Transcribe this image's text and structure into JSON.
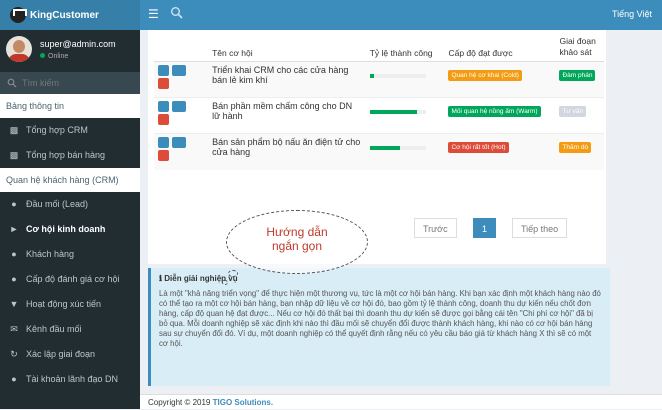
{
  "app": {
    "title": "KingCustomer",
    "language": "Tiếng Việt"
  },
  "user": {
    "name": "super@admin.com",
    "status": "Online"
  },
  "sidebar": {
    "search_placeholder": "Tìm kiếm",
    "section1": "Bảng thông tin",
    "items1": [
      {
        "label": "Tổng hợp CRM",
        "icon": "bar-chart-icon"
      },
      {
        "label": "Tổng hợp bán hàng",
        "icon": "bar-chart-icon"
      }
    ],
    "section2": "Quan hệ khách hàng (CRM)",
    "items2": [
      {
        "label": "Đầu mối (Lead)",
        "icon": "person-icon"
      },
      {
        "label": "Cơ hội kinh doanh",
        "icon": "megaphone-icon"
      },
      {
        "label": "Khách hàng",
        "icon": "person-icon"
      },
      {
        "label": "Cấp độ đánh giá cơ hội",
        "icon": "users-icon"
      },
      {
        "label": "Hoạt động xúc tiến",
        "icon": "filter-icon"
      },
      {
        "label": "Kênh đầu mối",
        "icon": "mail-icon"
      },
      {
        "label": "Xác lập giai đoạn",
        "icon": "refresh-icon"
      },
      {
        "label": "Tài khoản lãnh đạo DN",
        "icon": "user-tie-icon"
      }
    ]
  },
  "table": {
    "headers": {
      "name": "Tên cơ hội",
      "rate": "Tỷ lệ thành công",
      "level": "Cấp độ đạt được",
      "stage": "Giai đoạn khảo sát"
    },
    "rows": [
      {
        "name": "Triển khai CRM cho các cửa hàng bán lẻ kim khí",
        "progress": 0.08,
        "level": "Quan hệ cơ khai (Cold)",
        "level_color": "#f39c12",
        "stage": "Đàm phán",
        "stage_color": "#00a65a"
      },
      {
        "name": "Bán phần mềm chấm công cho DN lữ hành",
        "progress": 0.85,
        "level": "Mối quan hệ nồng ấm (Warm)",
        "level_color": "#00a65a",
        "stage": "Tư vấn",
        "stage_color": "#d2d6de"
      },
      {
        "name": "Bán sản phẩm bộ nấu ăn điện tử cho cửa hàng",
        "progress": 0.55,
        "level": "Cơ hội rất tốt (Hot)",
        "level_color": "#dd4b39",
        "stage": "Thăm dò",
        "stage_color": "#f39c12"
      }
    ]
  },
  "pagination": {
    "prev": "Trước",
    "page": "1",
    "next": "Tiếp theo"
  },
  "callout": "Hướng dẫn ngắn gọn",
  "note": {
    "title": "Diễn giải nghiệp vụ",
    "text": "Là một \"khả năng triển vọng\" để thực hiện một thương vụ, tức là một cơ hội bán hàng. Khi bạn xác định một khách hàng nào đó có thể tạo ra một cơ hội bán hàng, bạn nhập dữ liệu về cơ hội đó, bao gồm tỷ lệ thành công, doanh thu dự kiến nếu chốt đơn hàng, cấp độ quan hệ đạt được... Nếu cơ hội đó thất bại thì doanh thu dự kiến sẽ được gọi bằng cái tên \"Chi phí cơ hội\" đã bị bỏ qua. Mỗi doanh nghiệp sẽ xác định khi nào thì đầu mối sẽ chuyển đổi được thành khách hàng, khi nào có cơ hội bán hàng sau sự chuyển đổi đó. Ví dụ, một doanh nghiệp có thể quyết định rằng nếu có yêu cầu báo giá từ khách hàng X thì sẽ có một cơ hội."
  },
  "footer": {
    "prefix": "Copyright © 2019",
    "brand": "TIGO Solutions."
  }
}
